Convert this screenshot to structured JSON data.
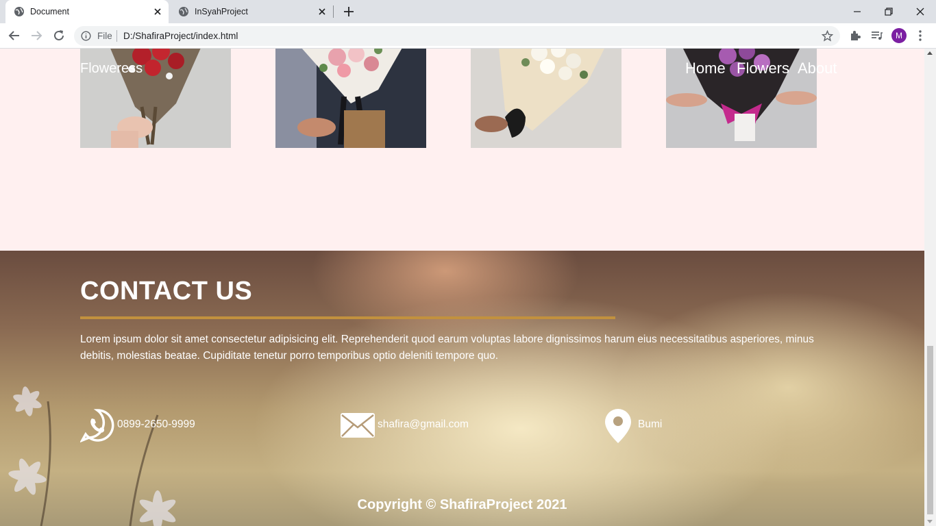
{
  "browser": {
    "tabs": [
      {
        "title": "Document",
        "active": true
      },
      {
        "title": "InSyahProject",
        "active": false
      }
    ],
    "address": {
      "scheme_label": "File",
      "url": "D:/ShafiraProject/index.html"
    },
    "profile_initial": "M"
  },
  "navbar": {
    "brand": "Floweress",
    "links": [
      "Home",
      "Flowers",
      "About"
    ]
  },
  "contact": {
    "title": "CONTACT US",
    "description": "Lorem ipsum dolor sit amet consectetur adipisicing elit. Reprehenderit quod earum voluptas labore dignissimos harum eius necessitatibus asperiores, minus debitis, molestias beatae. Cupiditate tenetur porro temporibus optio deleniti tempore quo.",
    "phone": "0899-2650-9999",
    "email": "shafira@gmail.com",
    "location": "Bumi"
  },
  "footer": {
    "copyright": "Copyright © ShafiraProject 2021"
  },
  "colors": {
    "page_bg": "#fff0f0",
    "accent_line": "#c2913e",
    "profile": "#7b1fa2"
  }
}
